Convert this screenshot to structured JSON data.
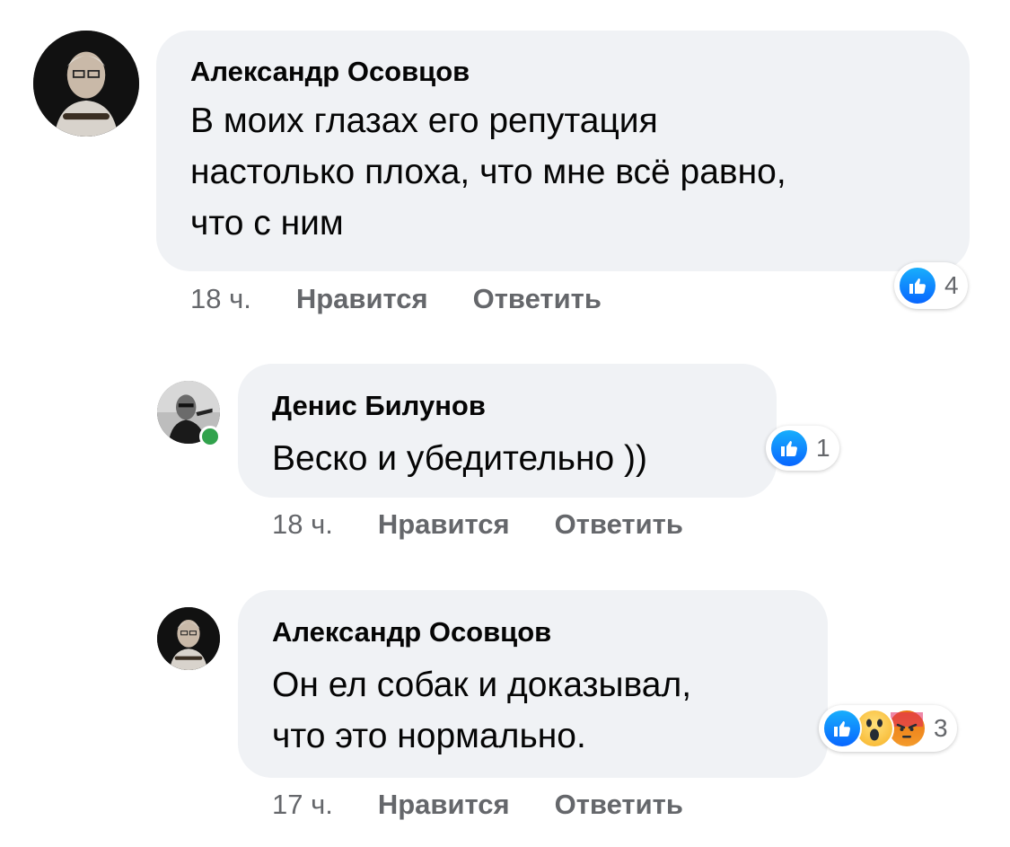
{
  "comments": [
    {
      "author": "Александр Осовцов",
      "text": "В моих глазах его репутация\nнастолько плоха, что мне всё равно,\nчто с ним",
      "time": "18 ч.",
      "like_label": "Нравится",
      "reply_label": "Ответить",
      "reactions": {
        "icons": [
          "like-icon"
        ],
        "count": "4"
      }
    },
    {
      "author": "Денис Билунов",
      "text": "Веско и убедительно ))",
      "time": "18 ч.",
      "like_label": "Нравится",
      "reply_label": "Ответить",
      "online": true,
      "reactions": {
        "icons": [
          "like-icon"
        ],
        "count": "1"
      }
    },
    {
      "author": "Александр Осовцов",
      "text": "Он ел собак и доказывал,\nчто это нормально.",
      "time": "17 ч.",
      "like_label": "Нравится",
      "reply_label": "Ответить",
      "reactions": {
        "icons": [
          "like-icon",
          "wow-icon",
          "angry-icon"
        ],
        "count": "3"
      }
    }
  ],
  "colors": {
    "bubble": "#f0f2f5",
    "meta_text": "#65676b",
    "like_blue": "#0866ff",
    "online_green": "#31a24c"
  }
}
